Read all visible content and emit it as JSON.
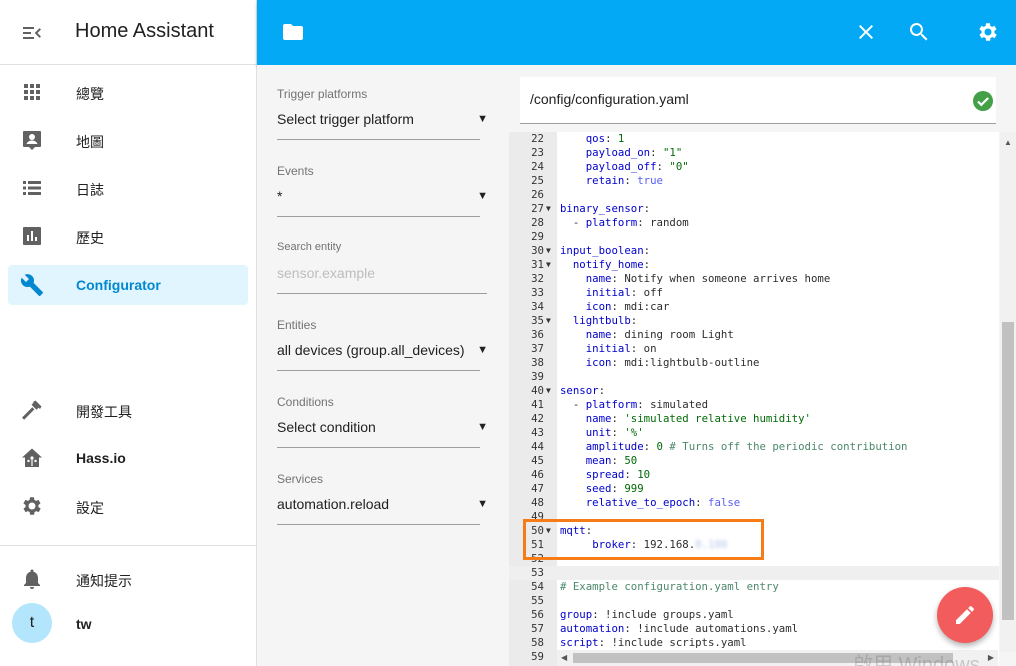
{
  "app": {
    "title": "Home Assistant"
  },
  "sidebar": {
    "items": [
      {
        "label": "總覽",
        "icon": "grid-icon"
      },
      {
        "label": "地圖",
        "icon": "account-box-icon"
      },
      {
        "label": "日誌",
        "icon": "list-icon"
      },
      {
        "label": "歷史",
        "icon": "chart-bar-icon"
      },
      {
        "label": "Configurator",
        "icon": "wrench-icon",
        "active": true
      },
      {
        "label": "開發工具",
        "icon": "hammer-icon"
      },
      {
        "label": "Hass.io",
        "icon": "hass-io-icon"
      },
      {
        "label": "設定",
        "icon": "gear-icon"
      }
    ],
    "notifications_label": "通知提示",
    "user": {
      "initial": "t",
      "name": "tw"
    }
  },
  "panel": {
    "fields": [
      {
        "label": "Trigger platforms",
        "value": "Select trigger platform",
        "dropdown": true
      },
      {
        "label": "Events",
        "value": "*",
        "dropdown": true
      },
      {
        "label": "Search entity",
        "placeholder": "sensor.example",
        "dropdown": false
      },
      {
        "label": "Entities",
        "value": "all devices (group.all_devices)",
        "dropdown": true
      },
      {
        "label": "Conditions",
        "value": "Select condition",
        "dropdown": true
      },
      {
        "label": "Services",
        "value": "automation.reload",
        "dropdown": true
      }
    ]
  },
  "editor": {
    "file_path": "/config/configuration.yaml",
    "status": "saved",
    "lines": [
      {
        "n": "22",
        "fold": false,
        "text": "    qos: 1"
      },
      {
        "n": "23",
        "fold": false,
        "text": "    payload_on: \"1\""
      },
      {
        "n": "24",
        "fold": false,
        "text": "    payload_off: \"0\""
      },
      {
        "n": "25",
        "fold": false,
        "text": "    retain: true"
      },
      {
        "n": "26",
        "fold": false,
        "text": ""
      },
      {
        "n": "27",
        "fold": true,
        "text": "binary_sensor:"
      },
      {
        "n": "28",
        "fold": false,
        "text": "  - platform: random"
      },
      {
        "n": "29",
        "fold": false,
        "text": ""
      },
      {
        "n": "30",
        "fold": true,
        "text": "input_boolean:"
      },
      {
        "n": "31",
        "fold": true,
        "text": "  notify_home:"
      },
      {
        "n": "32",
        "fold": false,
        "text": "    name: Notify when someone arrives home"
      },
      {
        "n": "33",
        "fold": false,
        "text": "    initial: off"
      },
      {
        "n": "34",
        "fold": false,
        "text": "    icon: mdi:car"
      },
      {
        "n": "35",
        "fold": true,
        "text": "  lightbulb:"
      },
      {
        "n": "36",
        "fold": false,
        "text": "    name: dining room Light"
      },
      {
        "n": "37",
        "fold": false,
        "text": "    initial: on"
      },
      {
        "n": "38",
        "fold": false,
        "text": "    icon: mdi:lightbulb-outline"
      },
      {
        "n": "39",
        "fold": false,
        "text": ""
      },
      {
        "n": "40",
        "fold": true,
        "text": "sensor:"
      },
      {
        "n": "41",
        "fold": false,
        "text": "  - platform: simulated"
      },
      {
        "n": "42",
        "fold": false,
        "text": "    name: 'simulated relative humidity'"
      },
      {
        "n": "43",
        "fold": false,
        "text": "    unit: '%'"
      },
      {
        "n": "44",
        "fold": false,
        "text": "    amplitude: 0 # Turns off the periodic contribution"
      },
      {
        "n": "45",
        "fold": false,
        "text": "    mean: 50"
      },
      {
        "n": "46",
        "fold": false,
        "text": "    spread: 10"
      },
      {
        "n": "47",
        "fold": false,
        "text": "    seed: 999"
      },
      {
        "n": "48",
        "fold": false,
        "text": "    relative_to_epoch: false"
      },
      {
        "n": "49",
        "fold": false,
        "text": ""
      },
      {
        "n": "50",
        "fold": true,
        "text": "mqtt:"
      },
      {
        "n": "51",
        "fold": false,
        "text": "     broker: 192.168."
      },
      {
        "n": "52",
        "fold": false,
        "text": ""
      },
      {
        "n": "53",
        "fold": false,
        "text": ""
      },
      {
        "n": "54",
        "fold": false,
        "text": "# Example configuration.yaml entry"
      },
      {
        "n": "55",
        "fold": false,
        "text": ""
      },
      {
        "n": "56",
        "fold": false,
        "text": "group: !include groups.yaml"
      },
      {
        "n": "57",
        "fold": false,
        "text": "automation: !include automations.yaml"
      },
      {
        "n": "58",
        "fold": false,
        "text": "script: !include scripts.yaml"
      },
      {
        "n": "59",
        "fold": false,
        "text": ""
      }
    ],
    "redacted_suffix": "0.100",
    "current_line": "53"
  },
  "watermark": "啟用 Windows",
  "colors": {
    "accent": "#03a9f4",
    "active_bg": "#e1f5fe",
    "active_text": "#0288d1",
    "fab": "#f25c5c",
    "check": "#43a047",
    "highlight": "#f57c16"
  }
}
